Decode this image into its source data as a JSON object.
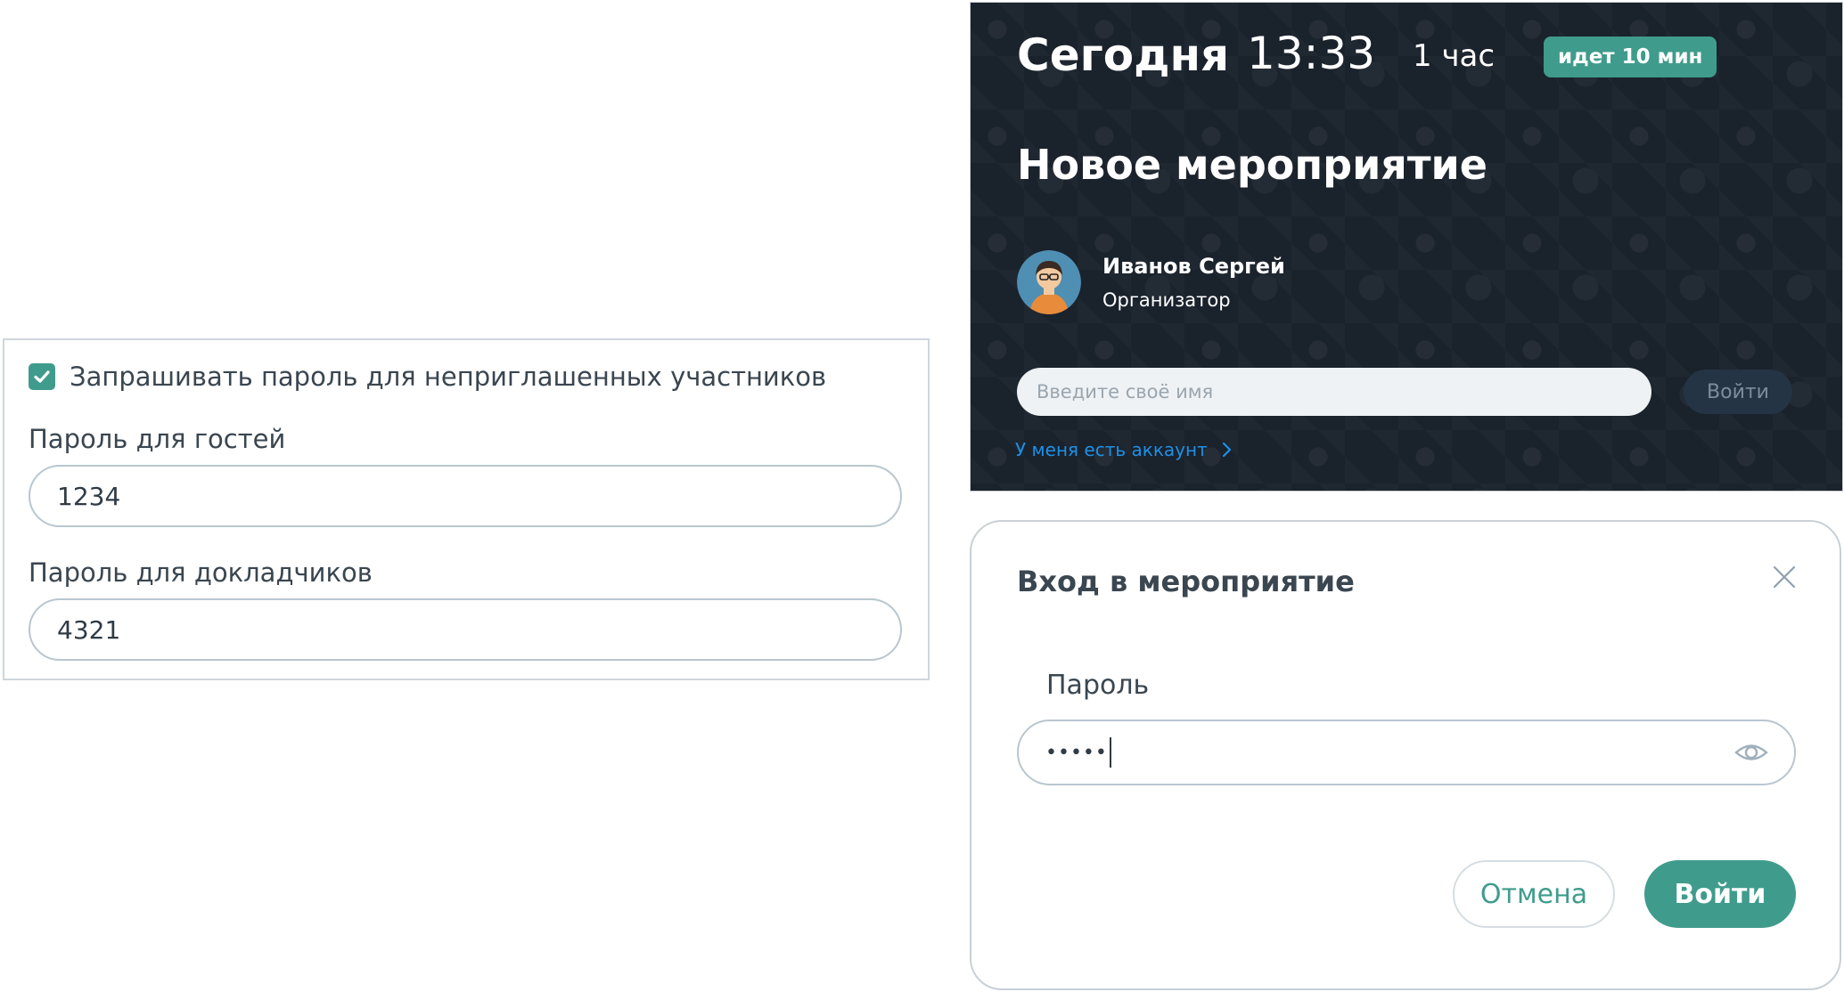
{
  "settings": {
    "require_password_label": "Запрашивать пароль для неприглашенных участников",
    "require_password_checked": true,
    "guest_password_label": "Пароль для гостей",
    "guest_password_value": "1234",
    "speaker_password_label": "Пароль для докладчиков",
    "speaker_password_value": "4321"
  },
  "event_card": {
    "day": "Сегодня",
    "time": "13:33",
    "duration": "1 час",
    "status_badge": "идет 10 мин",
    "title": "Новое мероприятие",
    "organizer_name": "Иванов Сергей",
    "organizer_role": "Организатор",
    "name_placeholder": "Введите своё имя",
    "login_button": "Войти",
    "account_link": "У меня есть аккаунт",
    "account_link_icon": "chevron-right-icon"
  },
  "dialog": {
    "title": "Вход в мероприятие",
    "close_icon": "close-icon",
    "password_label": "Пароль",
    "password_masked": "•••••",
    "reveal_icon": "eye-icon",
    "cancel_button": "Отмена",
    "login_button": "Войти"
  },
  "colors": {
    "accent": "#3f9c8c",
    "card_background": "#1a222c",
    "link": "#1e90e6",
    "border": "#b9c6cf"
  }
}
